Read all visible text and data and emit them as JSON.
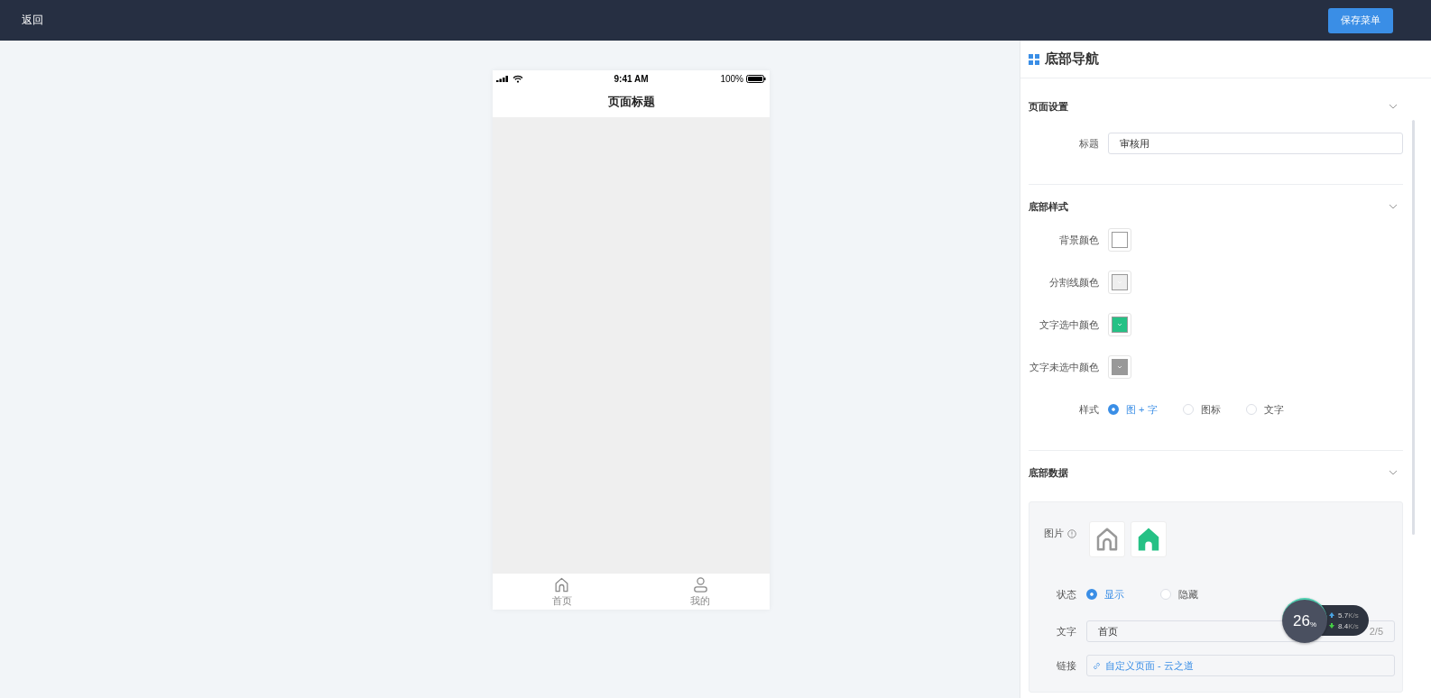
{
  "topbar": {
    "back": "返回",
    "save": "保存菜单"
  },
  "phone": {
    "time": "9:41 AM",
    "battery": "100%",
    "title": "页面标题",
    "tabs": [
      {
        "label": "首页",
        "kind": "home"
      },
      {
        "label": "我的",
        "kind": "user"
      }
    ]
  },
  "panel": {
    "title": "底部导航",
    "page_settings": {
      "title": "页面设置",
      "field": {
        "label": "标题",
        "value": "审核用"
      }
    },
    "bottom_style": {
      "title": "底部样式",
      "colors": [
        {
          "label": "背景颜色",
          "color": "#ffffff"
        },
        {
          "label": "分割线颜色",
          "color": "#eeeeee"
        },
        {
          "label": "文字选中颜色",
          "color": "#25c185"
        },
        {
          "label": "文字未选中颜色",
          "color": "#999999"
        }
      ],
      "style_label": "样式",
      "style_options": [
        {
          "label": "图 + 字",
          "selected": true
        },
        {
          "label": "图标",
          "selected": false
        },
        {
          "label": "文字",
          "selected": false
        }
      ]
    },
    "bottom_data": {
      "title": "底部数据",
      "item": {
        "image_label": "图片",
        "images": [
          {
            "kind": "outline",
            "color": "#999999"
          },
          {
            "kind": "filled",
            "color": "#25c185"
          }
        ],
        "status_label": "状态",
        "status_options": [
          {
            "label": "显示",
            "selected": true
          },
          {
            "label": "隐藏",
            "selected": false
          }
        ],
        "text_label": "文字",
        "text_value": "首页",
        "text_count": "2/5",
        "link_label": "链接",
        "link_value": "自定义页面 - 云之道"
      }
    }
  },
  "monitor": {
    "percent": "26",
    "unit": "%",
    "up": "5.7",
    "up_unit": "K/s",
    "down": "8.4",
    "down_unit": "K/s"
  }
}
